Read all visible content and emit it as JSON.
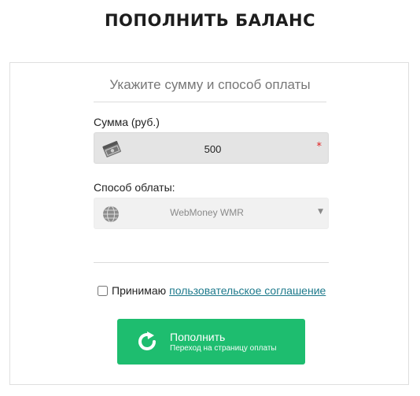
{
  "page": {
    "title": "ПОПОЛНИТЬ БАЛАНС"
  },
  "form": {
    "subtitle": "Укажите сумму и способ оплаты",
    "amount": {
      "label": "Сумма (руб.)",
      "value": "500",
      "required_mark": "*",
      "icon": "money-stack-icon"
    },
    "payment": {
      "label": "Способ облаты:",
      "selected": "WebMoney WMR",
      "icon": "webmoney-globe-icon",
      "arrow": "▼"
    },
    "agreement": {
      "text": "Принимаю",
      "link": "пользовательское соглашение",
      "checked": false
    },
    "submit": {
      "title": "Пополнить",
      "subtitle": "Переход на страницу оплаты",
      "icon": "refresh-icon"
    }
  },
  "colors": {
    "accent": "#1ebd6f",
    "link": "#1e7a8c",
    "required": "#e02020"
  }
}
